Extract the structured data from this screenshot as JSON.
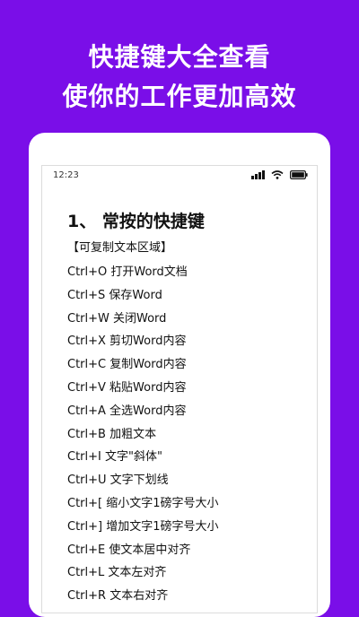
{
  "promo": {
    "line1": "快捷键大全查看",
    "line2": "使你的工作更加高效"
  },
  "status_bar": {
    "time": "12:23",
    "icons": [
      "signal-icon",
      "wifi-icon",
      "battery-icon"
    ]
  },
  "content": {
    "section_title": "1、 常按的快捷键",
    "copy_hint": "【可复制文本区域】",
    "shortcuts": [
      "Ctrl+O 打开Word文档",
      "Ctrl+S 保存Word",
      "Ctrl+W 关闭Word",
      "Ctrl+X 剪切Word内容",
      "Ctrl+C 复制Word内容",
      "Ctrl+V 粘贴Word内容",
      "Ctrl+A 全选Word内容",
      "Ctrl+B 加粗文本",
      "Ctrl+I 文字\"斜体\"",
      "Ctrl+U 文字下划线",
      "Ctrl+[ 缩小文字1磅字号大小",
      "Ctrl+] 增加文字1磅字号大小",
      "Ctrl+E 使文本居中对齐",
      "Ctrl+L 文本左对齐",
      "Ctrl+R 文本右对齐"
    ]
  },
  "colors": {
    "background": "#7a0ee8",
    "text": "#111111"
  }
}
